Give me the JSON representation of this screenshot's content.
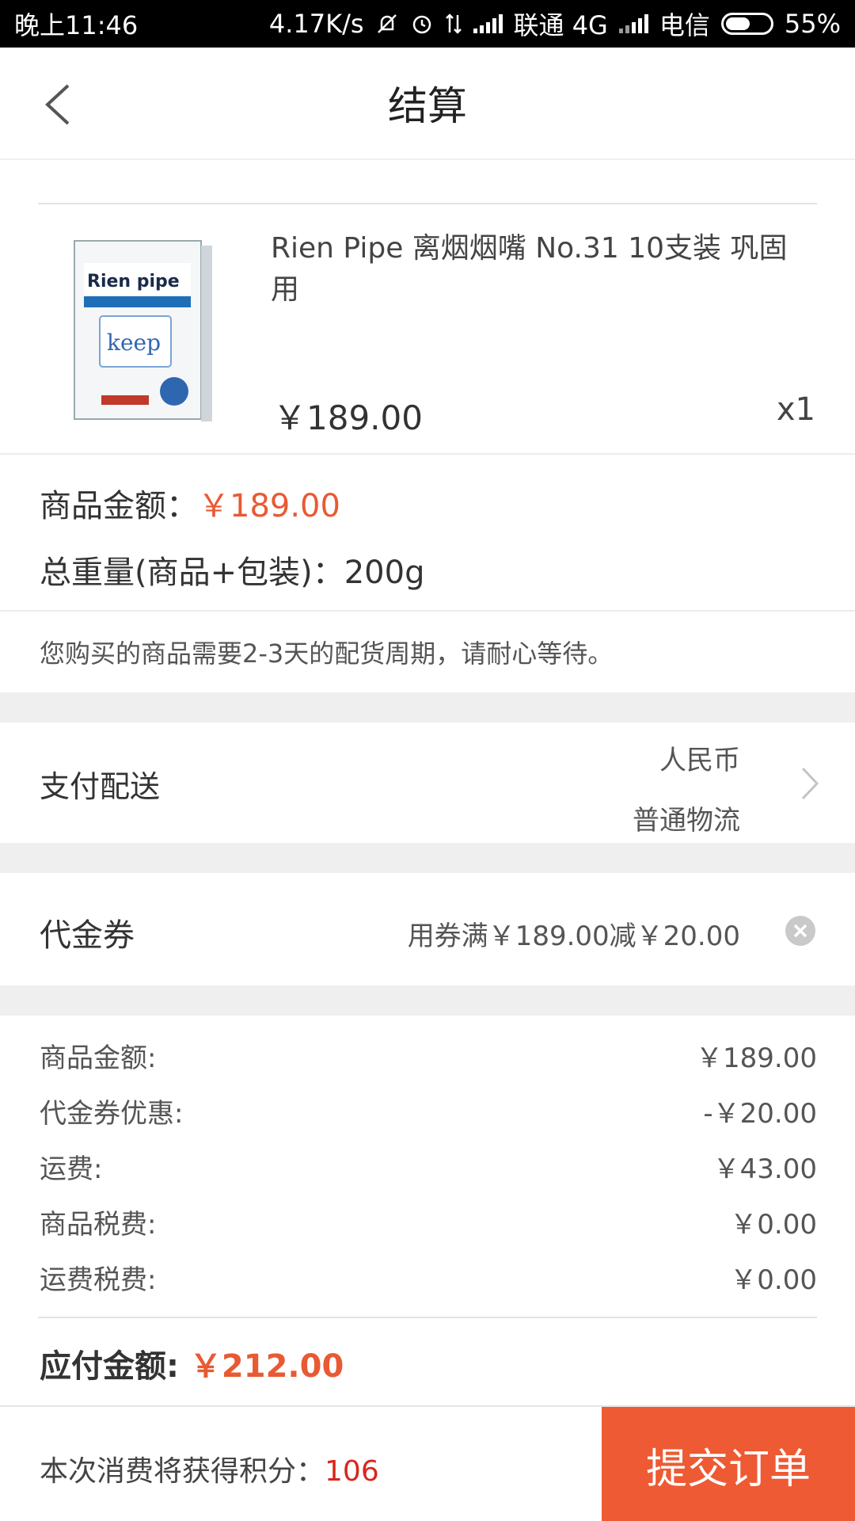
{
  "status_bar": {
    "time": "晚上11:46",
    "net_speed": "4.17K/s",
    "carrier1": "联通 4G",
    "carrier2": "电信",
    "battery": "55%"
  },
  "header": {
    "title": "结算"
  },
  "product": {
    "name": "Rien Pipe 离烟烟嘴 No.31 10支装 巩固用",
    "price": "￥189.00",
    "qty": "x1",
    "thumb_brand": "Rien pipe",
    "thumb_line": "keep"
  },
  "summary": {
    "amount_label": "商品金额：",
    "amount_value": "￥189.00",
    "weight_label": "总重量(商品+包装)：",
    "weight_value": "200g",
    "notice": "您购买的商品需要2-3天的配货周期，请耐心等待。"
  },
  "payment": {
    "label": "支付配送",
    "currency": "人民币",
    "shipping": "普通物流"
  },
  "coupon": {
    "label": "代金券",
    "value": "用券满￥189.00减￥20.00"
  },
  "totals": {
    "rows": [
      {
        "label": "商品金额:",
        "value": "￥189.00"
      },
      {
        "label": "代金券优惠:",
        "value": "-￥20.00"
      },
      {
        "label": "运费:",
        "value": "￥43.00"
      },
      {
        "label": "商品税费:",
        "value": "￥0.00"
      },
      {
        "label": "运费税费:",
        "value": "￥0.00"
      }
    ],
    "payable_label": "应付金额: ",
    "payable_value": "￥212.00"
  },
  "bottom": {
    "points_label": "本次消费将获得积分：",
    "points_value": "106",
    "submit_label": "提交订单"
  },
  "colors": {
    "accent": "#ee5a33",
    "price_orange": "#e85a33",
    "points_red": "#d9261c"
  }
}
